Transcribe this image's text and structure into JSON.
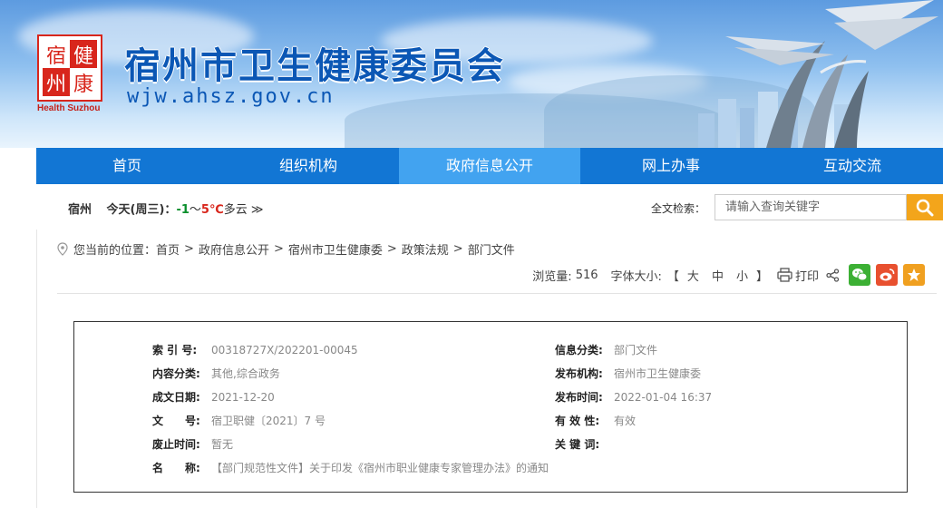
{
  "header": {
    "title": "宿州市卫生健康委员会",
    "domain": "wjw.ahsz.gov.cn",
    "logo_chars": [
      "宿",
      "健",
      "州",
      "康"
    ],
    "logo_en": "Health Suzhou"
  },
  "nav": {
    "items": [
      {
        "label": "首页",
        "active": false
      },
      {
        "label": "组织机构",
        "active": false
      },
      {
        "label": "政府信息公开",
        "active": true
      },
      {
        "label": "网上办事",
        "active": false
      },
      {
        "label": "互动交流",
        "active": false
      }
    ]
  },
  "weather": {
    "city": "宿州",
    "day": "今天(周三)：",
    "low": "-1",
    "tilde": "～",
    "high": "5℃",
    "condition": "多云",
    "more": "≫"
  },
  "search": {
    "label": "全文检索：",
    "placeholder": "请输入查询关键字"
  },
  "breadcrumb": {
    "prefix": "您当前的位置：",
    "items": [
      "首页",
      "政府信息公开",
      "宿州市卫生健康委",
      "政策法规",
      "部门文件"
    ],
    "sep": ">"
  },
  "tools": {
    "views_label": "浏览量:",
    "views": "516",
    "fontsize_label": "字体大小:",
    "open_bracket": "【",
    "close_bracket": "】",
    "size_large": "大",
    "size_medium": "中",
    "size_small": "小",
    "print": "打印"
  },
  "meta": {
    "left": [
      {
        "label": "索 引 号:",
        "value": "00318727X/202201-00045"
      },
      {
        "label": "内容分类:",
        "value": "其他,综合政务"
      },
      {
        "label": "成文日期:",
        "value": "2021-12-20"
      },
      {
        "label": "文　　号:",
        "value": "宿卫职健〔2021〕7 号"
      },
      {
        "label": "废止时间:",
        "value": "暂无"
      },
      {
        "label": "名　　称:",
        "value": "【部门规范性文件】关于印发《宿州市职业健康专家管理办法》的通知"
      }
    ],
    "right": [
      {
        "label": "信息分类:",
        "value": "部门文件"
      },
      {
        "label": "发布机构:",
        "value": "宿州市卫生健康委"
      },
      {
        "label": "发布时间:",
        "value": "2022-01-04 16:37"
      },
      {
        "label": "有 效 性:",
        "value": "有效"
      },
      {
        "label": "关 键 词:",
        "value": ""
      }
    ]
  },
  "colors": {
    "nav_bg": "#1276d4",
    "nav_active": "#42a3f0",
    "title": "#0b57b5",
    "logo_red": "#d8261c",
    "search_btn": "#f3a51b",
    "wechat": "#3cb034",
    "weibo": "#e8502f",
    "favorite": "#f0a020"
  }
}
